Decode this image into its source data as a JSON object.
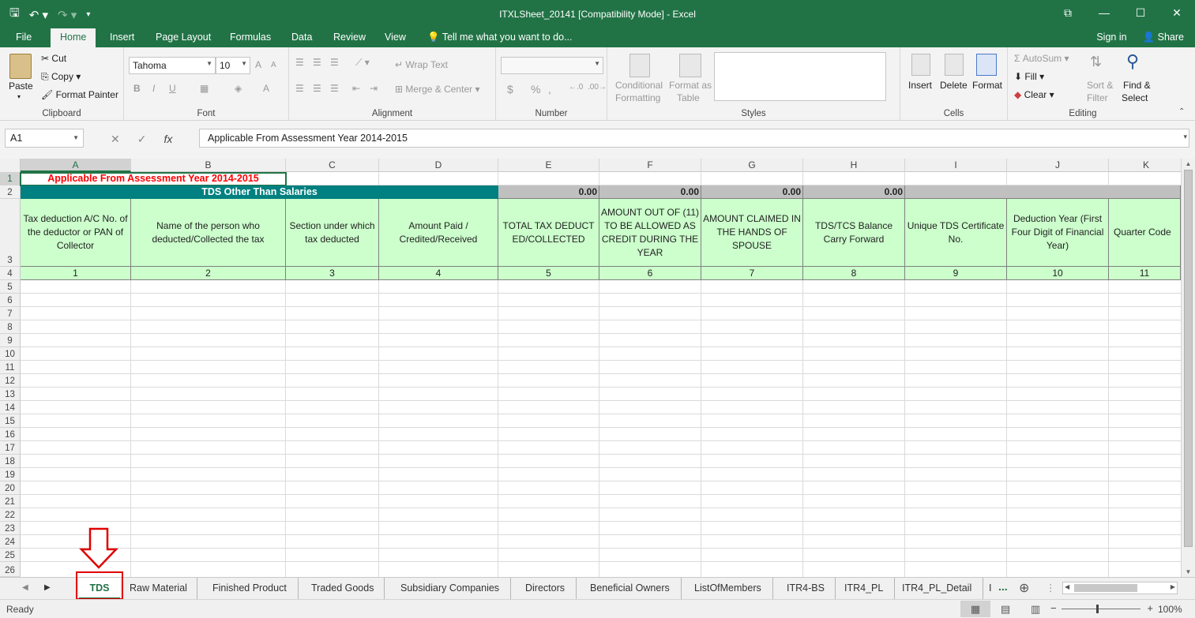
{
  "window": {
    "title": "ITXLSheet_20141  [Compatibility Mode] - Excel",
    "controls": [
      "⧉",
      "—",
      "☐",
      "✕"
    ]
  },
  "ribbon_tabs": [
    "File",
    "Home",
    "Insert",
    "Page Layout",
    "Formulas",
    "Data",
    "Review",
    "View"
  ],
  "tell_me": "Tell me what you want to do...",
  "sign_in": "Sign in",
  "share": "Share",
  "clipboard": {
    "paste": "Paste",
    "cut": "Cut",
    "copy": "Copy",
    "format_painter": "Format Painter",
    "label": "Clipboard"
  },
  "font": {
    "name": "Tahoma",
    "size": "10",
    "label": "Font",
    "bold": "B",
    "italic": "I",
    "underline": "U",
    "grow": "A",
    "shrink": "A"
  },
  "alignment": {
    "wrap_text": "Wrap Text",
    "merge_center": "Merge & Center",
    "label": "Alignment"
  },
  "number": {
    "format": "",
    "currency": "$",
    "percent": "%",
    "comma": ",",
    "label": "Number"
  },
  "styles": {
    "conditional_1": "Conditional",
    "conditional_2": "Formatting",
    "format_table_1": "Format as",
    "format_table_2": "Table",
    "label": "Styles"
  },
  "cells_group": {
    "insert": "Insert",
    "delete": "Delete",
    "format": "Format",
    "label": "Cells"
  },
  "editing": {
    "autosum": "AutoSum",
    "fill": "Fill",
    "clear": "Clear",
    "sort_1": "Sort &",
    "sort_2": "Filter",
    "find_1": "Find &",
    "find_2": "Select",
    "label": "Editing"
  },
  "formula_bar": {
    "name_box": "A1",
    "fx": "fx",
    "content": "Applicable From Assessment Year 2014-2015"
  },
  "columns": [
    "A",
    "B",
    "C",
    "D",
    "E",
    "F",
    "G",
    "H",
    "I",
    "J",
    "K"
  ],
  "rows": [
    "1",
    "2",
    "3",
    "4",
    "5",
    "6",
    "7",
    "8",
    "9",
    "10",
    "11",
    "12",
    "13",
    "14",
    "15",
    "16",
    "17",
    "18",
    "19",
    "20",
    "21",
    "22",
    "23",
    "24",
    "25",
    "26"
  ],
  "sheet": {
    "a1": "Applicable From Assessment Year 2014-2015",
    "row2_title": "TDS Other Than Salaries",
    "row2_values": [
      "0.00",
      "0.00",
      "0.00",
      "0.00"
    ],
    "headers": [
      "Tax deduction A/C No. of the deductor or PAN of Collector",
      "Name of the person who deducted/Collected  the tax",
      "Section under which tax deducted",
      "Amount Paid / Credited/Received",
      "TOTAL TAX DEDUCTED/COLLECTED",
      "AMOUNT OUT OF (11) TO BE ALLOWED AS CREDIT DURING THE YEAR",
      "AMOUNT CLAIMED IN THE HANDS OF SPOUSE",
      "TDS/TCS Balance Carry Forward",
      "Unique TDS Certificate No.",
      "Deduction Year (First Four Digit of Financial Year)",
      "Quarter Code"
    ],
    "row4": [
      "1",
      "2",
      "3",
      "4",
      "5",
      "6",
      "7",
      "8",
      "9",
      "10",
      "11"
    ]
  },
  "sheet_tabs": [
    "TDS",
    "Raw Material",
    "Finished Product",
    "Traded Goods",
    "Subsidiary Companies",
    "Directors",
    "Beneficial Owners",
    "ListOfMembers",
    "ITR4-BS",
    "ITR4_PL",
    "ITR4_PL_Detail",
    "I"
  ],
  "sheet_more": "...",
  "status": {
    "ready": "Ready",
    "zoom": "100%"
  }
}
